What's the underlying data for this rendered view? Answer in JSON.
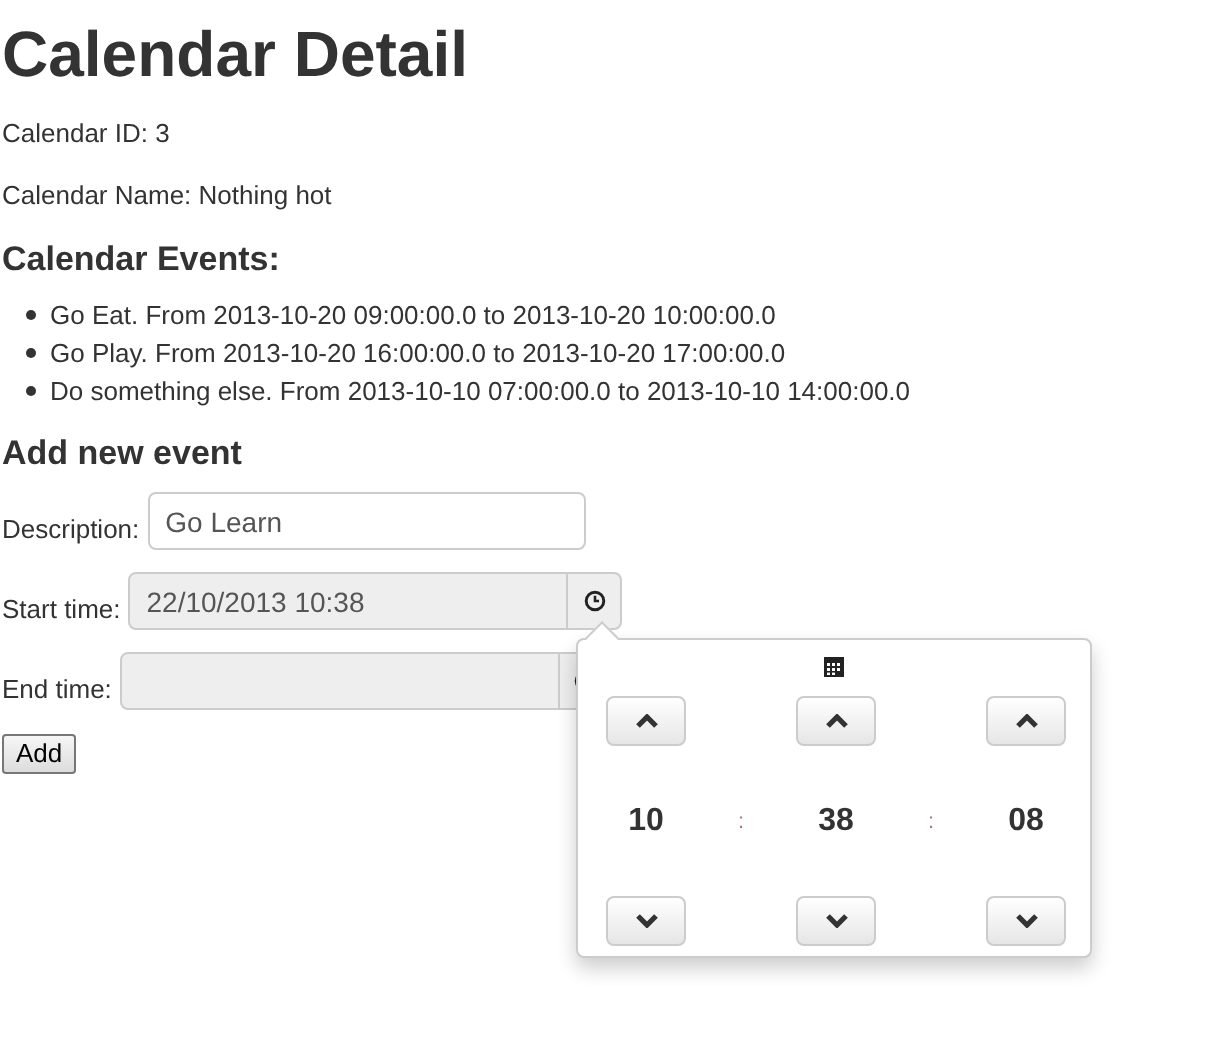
{
  "title": "Calendar Detail",
  "info": [
    "Calendar ID: 3",
    "Calendar Name: Nothing hot"
  ],
  "events_heading": "Calendar Events:",
  "events": [
    "Go Eat. From 2013-10-20 09:00:00.0 to 2013-10-20 10:00:00.0",
    "Go Play. From 2013-10-20 16:00:00.0 to 2013-10-20 17:00:00.0",
    "Do something else. From 2013-10-10 07:00:00.0 to 2013-10-10 14:00:00.0"
  ],
  "form_heading": "Add new event",
  "fields": [
    {
      "kind": "text",
      "label": "Description:",
      "value": "Go Learn"
    },
    {
      "kind": "datetime",
      "label": "Start time:",
      "value": "22/10/2013 10:38"
    },
    {
      "kind": "datetime",
      "label": "End time:"
    }
  ],
  "submit": "Add",
  "time_picker": {
    "hours": "10",
    "minutes": "38",
    "seconds": "08",
    "separators": [
      ":",
      ":"
    ]
  }
}
